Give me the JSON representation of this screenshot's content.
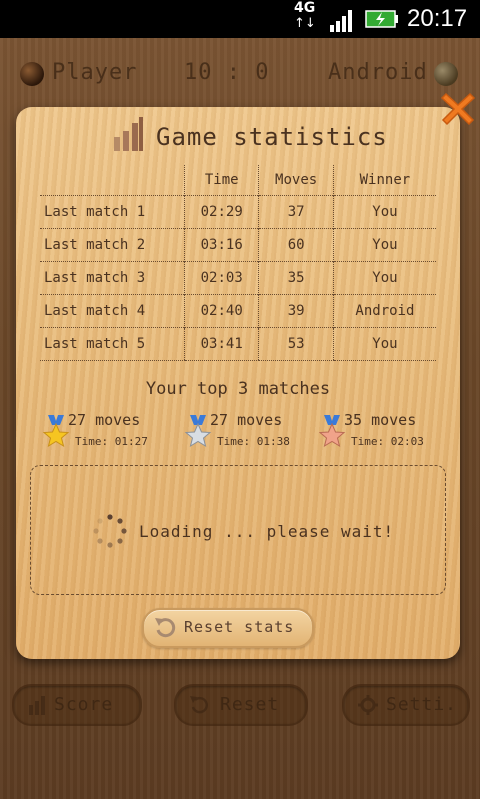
{
  "status_bar": {
    "network": "4G",
    "time": "20:17",
    "signal_icon": "signal-bars-icon",
    "battery_icon": "battery-charging-icon"
  },
  "scoreboard": {
    "player_label": "Player",
    "score": "10 : 0",
    "opponent_label": "Android"
  },
  "dialog": {
    "title": "Game statistics",
    "title_icon": "bar-chart-icon",
    "close_icon": "close-icon",
    "table": {
      "headers": [
        "",
        "Time",
        "Moves",
        "Winner"
      ],
      "rows": [
        {
          "label": "Last match 1",
          "time": "02:29",
          "moves": "37",
          "winner": "You"
        },
        {
          "label": "Last match 2",
          "time": "03:16",
          "moves": "60",
          "winner": "You"
        },
        {
          "label": "Last match 3",
          "time": "02:03",
          "moves": "35",
          "winner": "You"
        },
        {
          "label": "Last match 4",
          "time": "02:40",
          "moves": "39",
          "winner": "Android"
        },
        {
          "label": "Last match 5",
          "time": "03:41",
          "moves": "53",
          "winner": "You"
        }
      ]
    },
    "top_matches": {
      "title": "Your top 3 matches",
      "items": [
        {
          "medal": "gold",
          "moves": "27 moves",
          "time": "Time: 01:27"
        },
        {
          "medal": "silver",
          "moves": "27 moves",
          "time": "Time: 01:38"
        },
        {
          "medal": "bronze",
          "moves": "35 moves",
          "time": "Time: 02:03"
        }
      ]
    },
    "loading_text": "Loading ... please wait!",
    "reset_stats_label": "Reset stats"
  },
  "bottom_bar": {
    "score_label": "Score",
    "reset_label": "Reset",
    "settings_label": "Setti."
  },
  "colors": {
    "wood_dark": "#6e4a2a",
    "panel": "#e8bb7b",
    "text": "#4a3220",
    "close_orange": "#f07a20"
  }
}
